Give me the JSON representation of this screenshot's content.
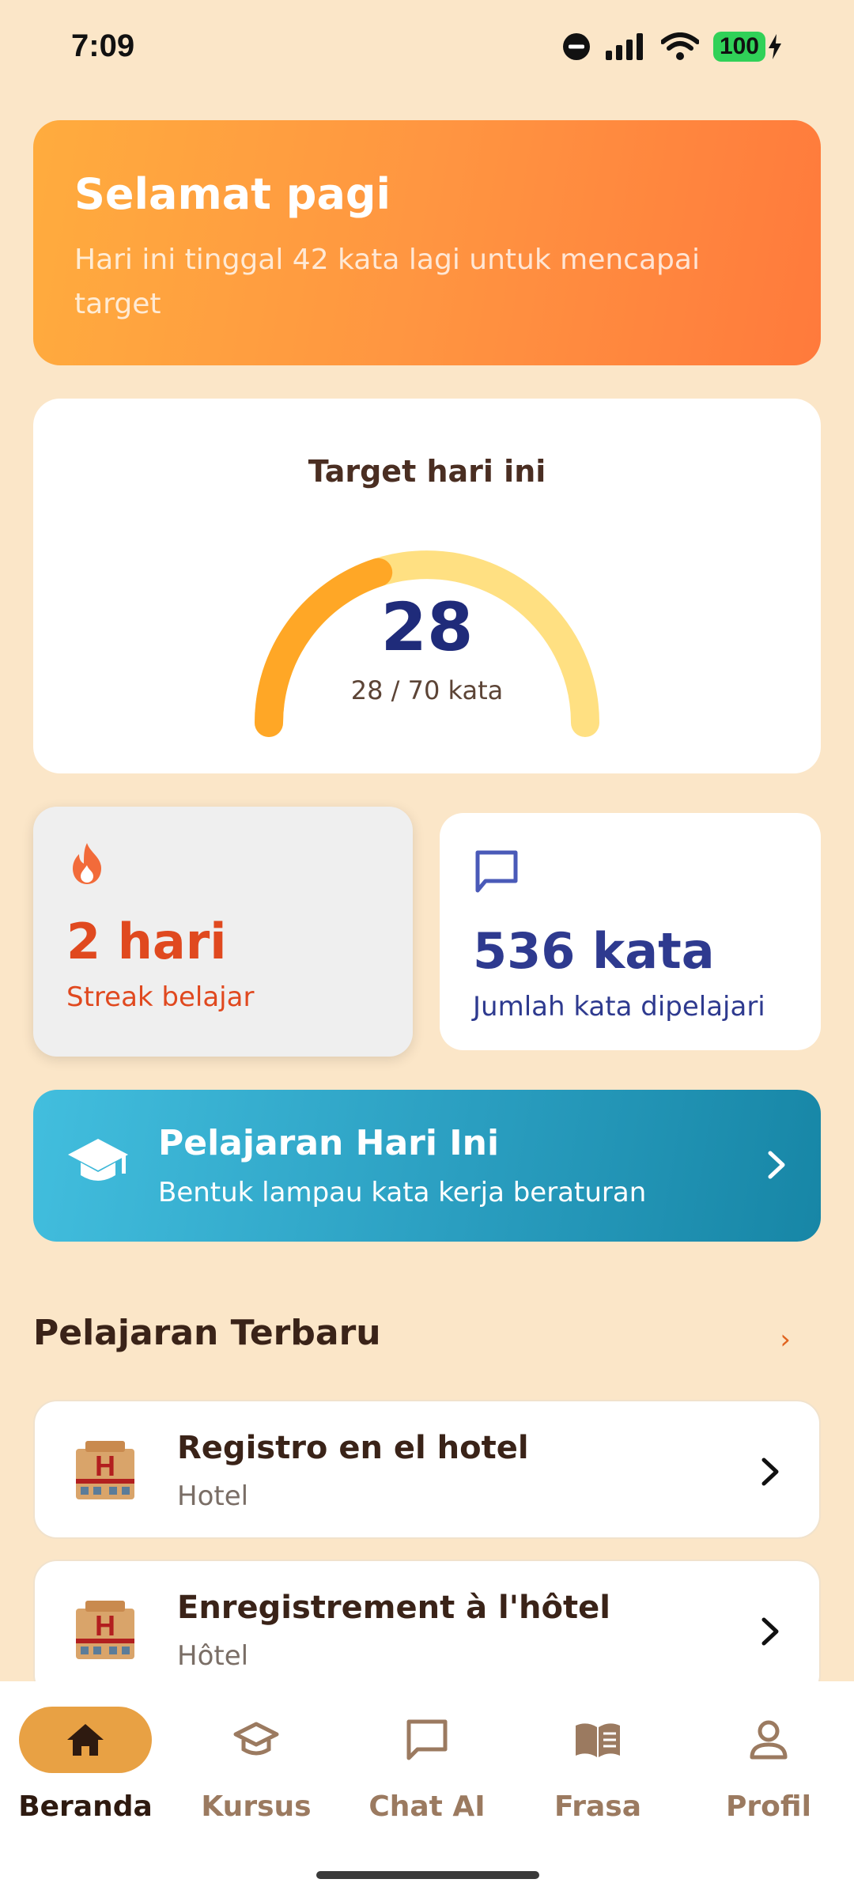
{
  "status_bar": {
    "time": "7:09",
    "battery": "100"
  },
  "greeting": {
    "title": "Selamat pagi",
    "subtitle": "Hari ini tinggal 42 kata lagi untuk mencapai target"
  },
  "target": {
    "title": "Target hari ini",
    "value": "28",
    "caption": "28 / 70 kata",
    "progress_fraction": 0.4,
    "colors": {
      "filled": "#FFA726",
      "track": "#FFE082"
    }
  },
  "stats": {
    "streak": {
      "value": "2 hari",
      "label": "Streak belajar",
      "icon": "fire-icon"
    },
    "words": {
      "value": "536 kata",
      "label": "Jumlah kata dipelajari",
      "icon": "chat-bubble-icon"
    }
  },
  "today_lesson": {
    "title": "Pelajaran Hari Ini",
    "subtitle": "Bentuk lampau kata kerja beraturan",
    "icon": "graduation-cap-icon"
  },
  "recent": {
    "title": "Pelajaran Terbaru",
    "more": "›",
    "items": [
      {
        "title": "Registro en el hotel",
        "subtitle": "Hotel",
        "icon": "hotel-emoji-icon"
      },
      {
        "title": "Enregistrement à l'hôtel",
        "subtitle": "Hôtel",
        "icon": "hotel-emoji-icon"
      }
    ]
  },
  "nav": {
    "items": [
      {
        "label": "Beranda",
        "icon": "home-icon",
        "active": true
      },
      {
        "label": "Kursus",
        "icon": "school-icon",
        "active": false
      },
      {
        "label": "Chat AI",
        "icon": "chat-icon",
        "active": false
      },
      {
        "label": "Frasa",
        "icon": "book-icon",
        "active": false
      },
      {
        "label": "Profil",
        "icon": "person-icon",
        "active": false
      }
    ]
  },
  "colors": {
    "background": "#FBE6C8",
    "accent_orange": "#FF8A3D",
    "streak_red": "#E0491F",
    "words_blue": "#2E3A8F",
    "nav_active": "#E8A144"
  }
}
